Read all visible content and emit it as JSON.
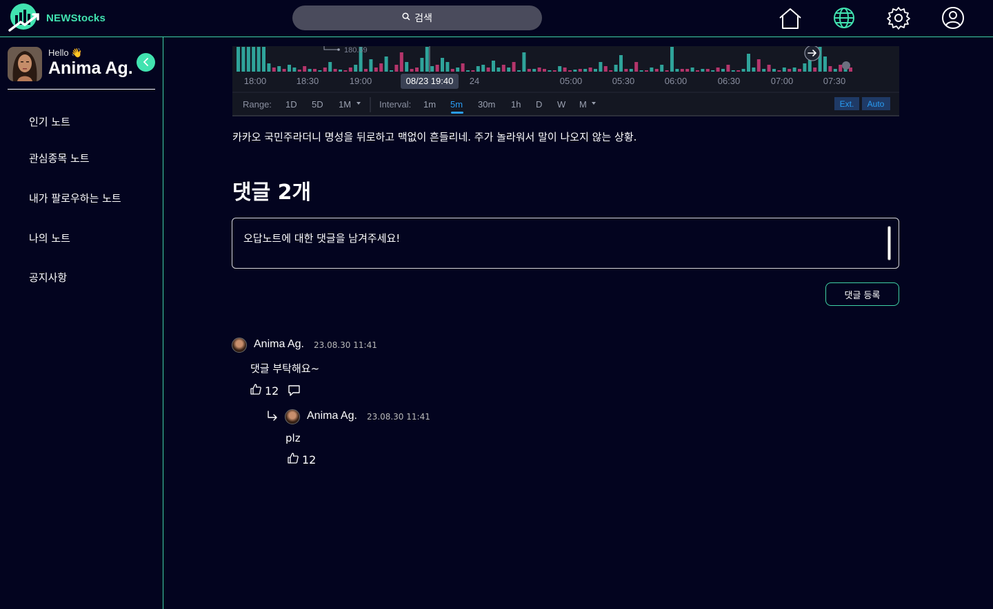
{
  "app": {
    "name": "NEWStocks",
    "accent": "#41e3b0"
  },
  "header": {
    "search_placeholder": "검색",
    "icons": [
      "home-icon",
      "globe-icon",
      "settings-icon",
      "user-icon"
    ]
  },
  "sidebar": {
    "hello": "Hello 👋",
    "username": "Anima Ag.",
    "items": [
      {
        "label": "인기 노트"
      },
      {
        "label": "관심종목 노트"
      },
      {
        "label": "내가 팔로우하는 노트"
      },
      {
        "label": "나의 노트"
      },
      {
        "label": "공지사항"
      }
    ]
  },
  "chart": {
    "price_label": "180.69",
    "time_ticks": [
      "18:00",
      "18:30",
      "19:00",
      "24",
      "05:00",
      "05:30",
      "06:00",
      "06:30",
      "07:00",
      "07:30"
    ],
    "cursor_label": "08/23 19:40",
    "range_label": "Range:",
    "ranges": [
      "1D",
      "5D",
      "1M"
    ],
    "interval_label": "Interval:",
    "intervals": [
      "1m",
      "5m",
      "30m",
      "1h",
      "D",
      "W",
      "M"
    ],
    "active_interval": "5m",
    "toggles": [
      "Ext.",
      "Auto"
    ],
    "up_color": "#2fa39a",
    "down_color": "#b4356b"
  },
  "post": {
    "text": "카카오 국민주라더니 명성을 뒤로하고 맥없이 흔들리네. 주가 놀라워서 말이 나오지 않는 상황."
  },
  "comments_section": {
    "title": "댓글 2개",
    "input_placeholder": "오답노트에 대한 댓글을 남겨주세요!",
    "submit_label": "댓글 등록",
    "comments": [
      {
        "author": "Anima Ag.",
        "time": "23.08.30 11:41",
        "body": "댓글 부탁해요~",
        "likes": "12",
        "replies": [
          {
            "author": "Anima Ag.",
            "time": "23.08.30 11:41",
            "body": "plz",
            "likes": "12"
          }
        ]
      }
    ]
  }
}
